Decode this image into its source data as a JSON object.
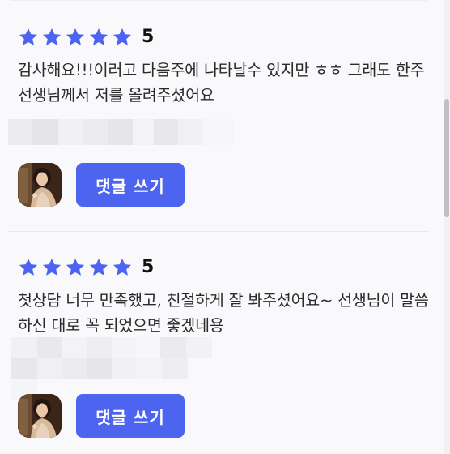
{
  "reviews": [
    {
      "stars": 5,
      "score": "5",
      "text": "감사해요!!!이러고 다음주에 나타날수 있지만 ㅎㅎ 그래도 한주 선생님께서 저를 올려주셨어요",
      "comment_button": "댓글 쓰기"
    },
    {
      "stars": 5,
      "score": "5",
      "text": "첫상담 너무 만족했고, 친절하게 잘 봐주셨어요~ 선생님이 말씀하신 대로 꼭 되었으면 좋겠네용",
      "comment_button": "댓글 쓰기"
    }
  ],
  "colors": {
    "star": "#4c64f0",
    "button": "#4c64f0",
    "background": "#f9f9fc"
  },
  "icons": {
    "star": "star-icon",
    "avatar": "counselor-avatar"
  }
}
